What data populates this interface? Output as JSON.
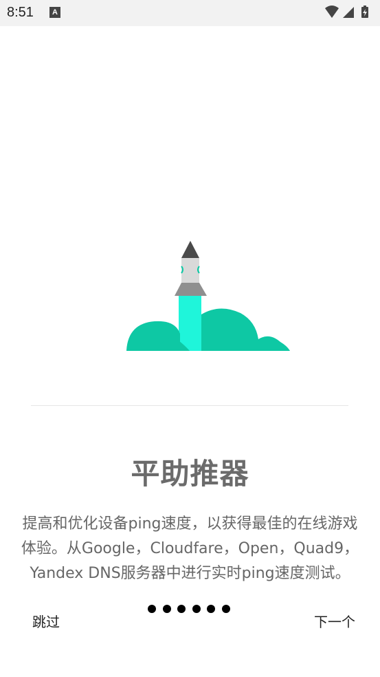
{
  "status_bar": {
    "time": "8:51",
    "notification_icon": "text-a-icon",
    "notification_glyph": "A",
    "icons": [
      "wifi-icon",
      "signal-icon",
      "battery-charging-icon"
    ]
  },
  "onboarding": {
    "illustration": "rocket-launch-illustration",
    "title": "平助推器",
    "description": "提高和优化设备ping速度，以获得最佳的在线游戏体验。从Google，Cloudfare，Open，Quad9，Yandex DNS服务器中进行实时ping速度测试。",
    "skip_label": "跳过",
    "next_label": "下一个",
    "page_count": 6
  },
  "colors": {
    "cloud": "#0ec8a4",
    "exhaust": "#1ff5da",
    "rocket_nose": "#4a4a4a",
    "rocket_body": "#d9d9d9",
    "rocket_fin": "#8f8f8f",
    "title_text": "#6b6b6b",
    "body_text": "#666666"
  }
}
